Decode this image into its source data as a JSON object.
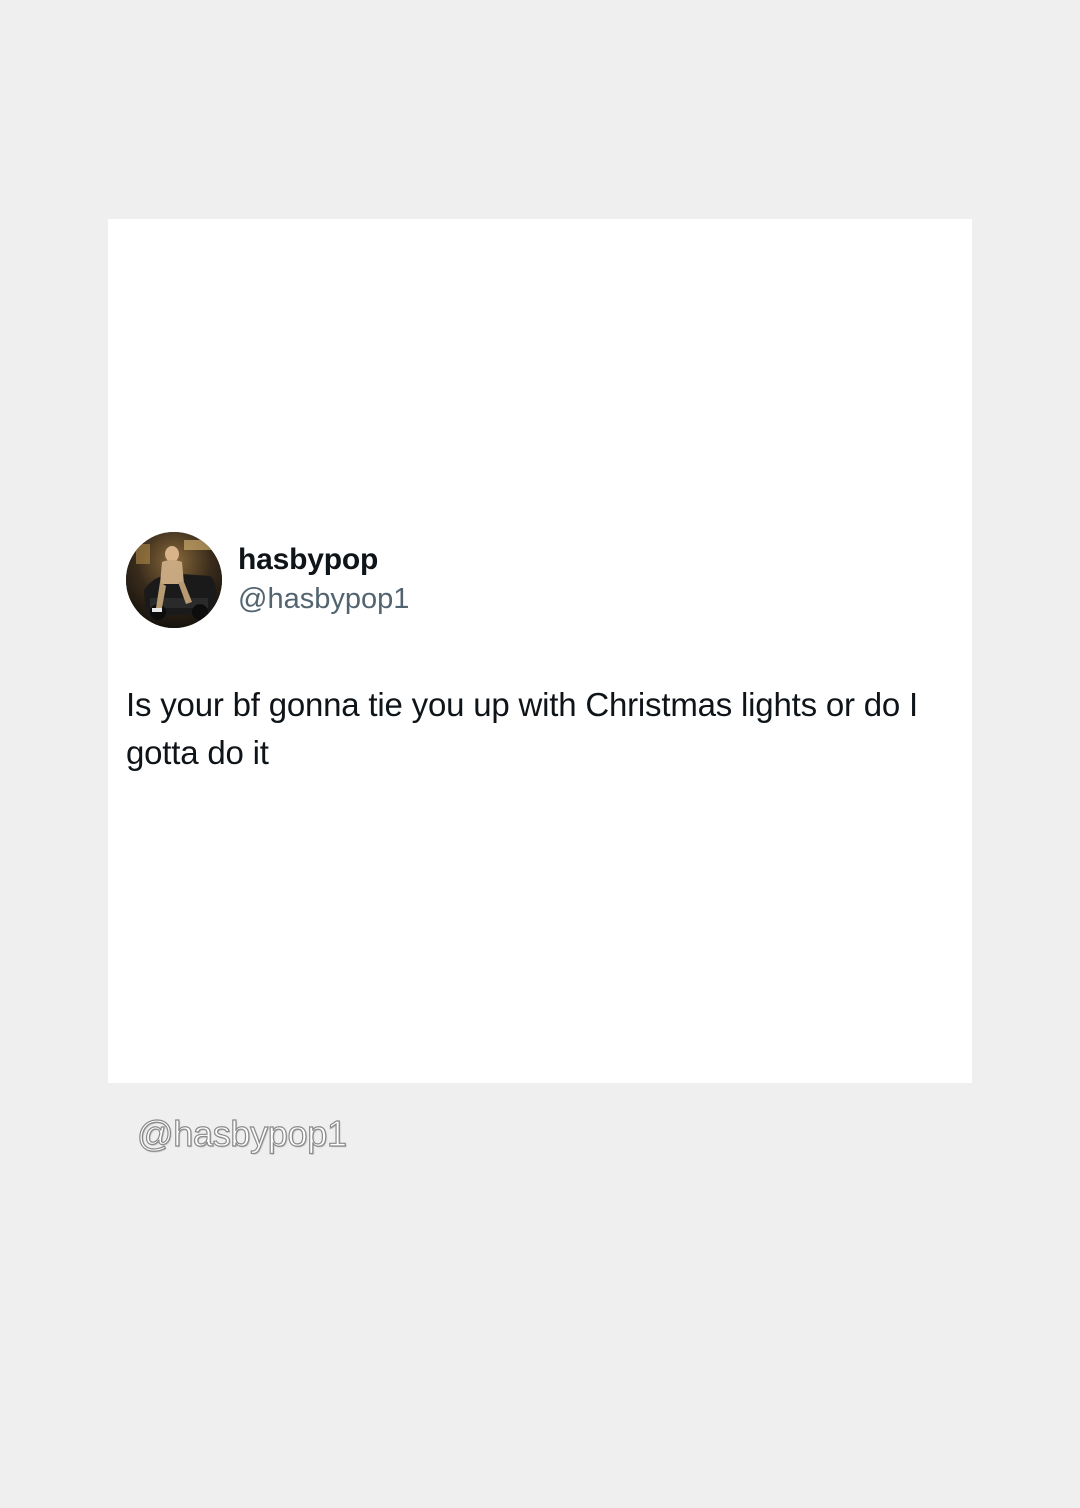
{
  "tweet": {
    "display_name": "hasbypop",
    "handle": "@hasbypop1",
    "text": "Is your bf gonna tie you up with Christmas lights or do I gotta do it",
    "avatar_icon": "profile-photo"
  },
  "watermark": {
    "text": "@hasbypop1"
  },
  "colors": {
    "page_background": "#efeff0",
    "card_background": "#ffffff",
    "primary_text": "#0f1419",
    "secondary_text": "#536471"
  }
}
